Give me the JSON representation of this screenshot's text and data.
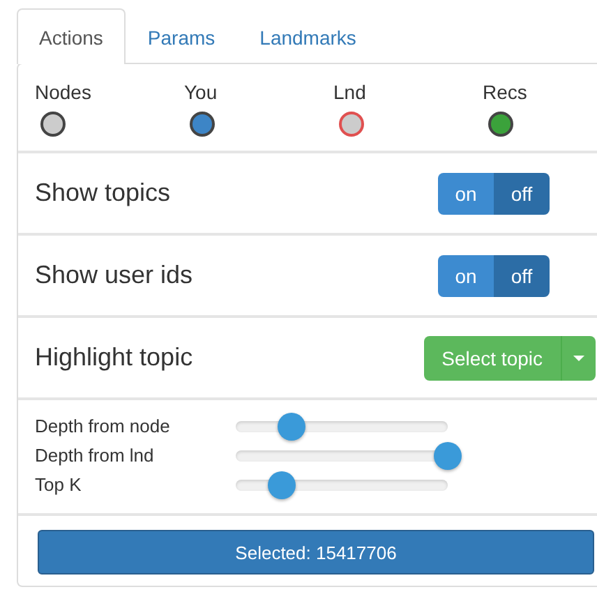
{
  "tabs": [
    {
      "label": "Actions",
      "selected": true
    },
    {
      "label": "Params",
      "selected": false
    },
    {
      "label": "Landmarks",
      "selected": false
    }
  ],
  "legend": [
    {
      "label": "Nodes",
      "color": "#cccccc",
      "kind": "plain"
    },
    {
      "label": "You",
      "color": "#3d85c6",
      "kind": "plain"
    },
    {
      "label": "Lnd",
      "color": "#cccccc",
      "kind": "ringed"
    },
    {
      "label": "Recs",
      "color": "#3ba23b",
      "kind": "plain"
    }
  ],
  "toggles": [
    {
      "label": "Show topics",
      "on_label": "on",
      "off_label": "off",
      "on": false
    },
    {
      "label": "Show user ids",
      "on_label": "on",
      "off_label": "off",
      "on": false
    }
  ],
  "highlight": {
    "label": "Highlight topic",
    "button": "Select topic"
  },
  "sliders": [
    {
      "label": "Depth from node",
      "level": 0.26
    },
    {
      "label": "Depth from lnd",
      "level": 1.0
    },
    {
      "label": "Top K",
      "level": 0.22
    }
  ],
  "selected_button": "Selected: 15417706"
}
